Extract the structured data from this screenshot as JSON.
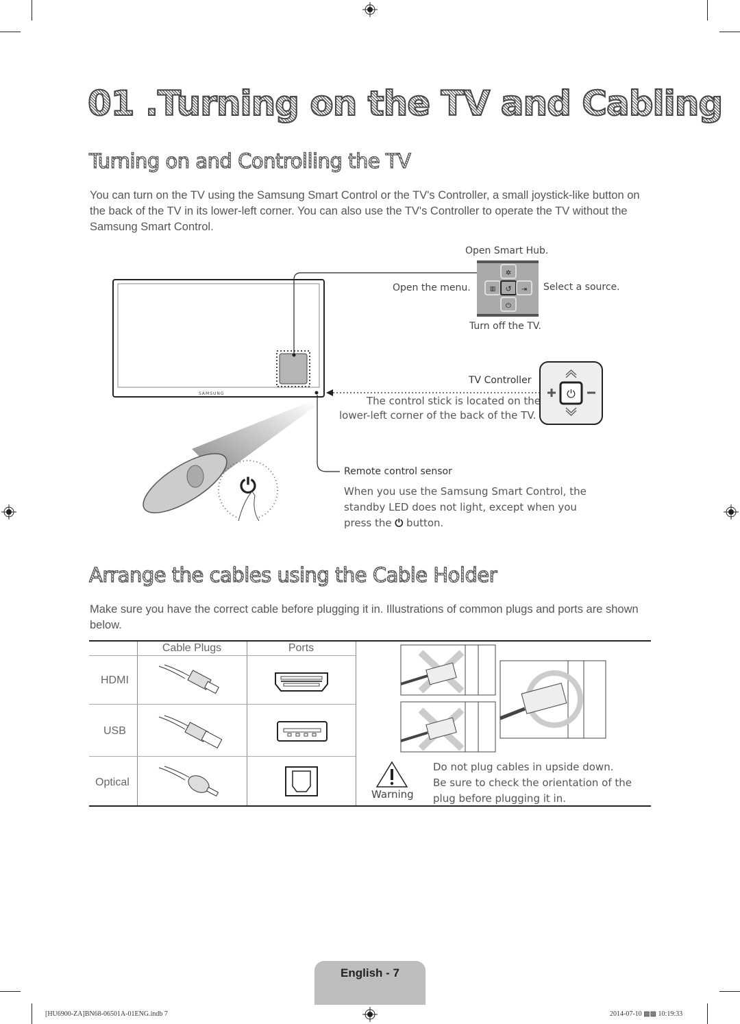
{
  "chapter_title": "01 .Turning on the TV and Cabling",
  "section1": {
    "title": "Turning on and Controlling the TV",
    "body": "You can turn on the TV using the Samsung Smart Control or the TV's Controller, a small joystick-like button on the back of the TV in its lower-left corner. You can also use the TV's Controller to operate the TV without the Samsung Smart Control.",
    "tv_brand": "SAMSUNG",
    "controller_menu": {
      "up": "Open Smart Hub.",
      "left": "Open the menu.",
      "right": "Select a source.",
      "down": "Turn off the TV."
    },
    "tv_controller": {
      "title": "TV Controller",
      "desc_line1": "The control stick is located on the",
      "desc_line2": "lower-left corner of the back of the TV."
    },
    "remote_sensor": {
      "title": "Remote control sensor",
      "line1": "When you use the Samsung Smart Control, the",
      "line2": "standby LED does not light, except when you",
      "line3_pre": "press the",
      "line3_post": "button."
    }
  },
  "section2": {
    "title": "Arrange the cables using the Cable Holder",
    "body": "Make sure you have the correct cable before plugging it in. Illustrations of common plugs and ports are shown below.",
    "table": {
      "headers": [
        "",
        "Cable Plugs",
        "Ports"
      ],
      "rows": [
        {
          "label": "HDMI"
        },
        {
          "label": "USB"
        },
        {
          "label": "Optical"
        }
      ]
    },
    "warning": {
      "label": "Warning",
      "line1": "Do not plug cables in upside down.",
      "line2": "Be sure to check the orientation of the",
      "line3": "plug before plugging it in."
    }
  },
  "page_label": "English - 7",
  "footer": {
    "file": "[HU6900-ZA]BN68-06501A-01ENG.indb   7",
    "timestamp": "2014-07-10   ▩▩ 10:19:33"
  }
}
